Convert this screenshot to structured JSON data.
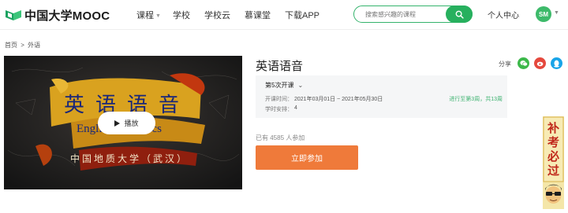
{
  "header": {
    "logo_text": "中国大学MOOC",
    "nav": [
      {
        "label": "课程",
        "has_caret": true
      },
      {
        "label": "学校"
      },
      {
        "label": "学校云"
      },
      {
        "label": "慕课堂"
      },
      {
        "label": "下载APP"
      }
    ],
    "search_placeholder": "搜索感兴趣的课程",
    "personal_center": "个人中心",
    "avatar_text": "SM"
  },
  "breadcrumb": {
    "items": [
      "首页",
      "外语"
    ],
    "separator": ">"
  },
  "video": {
    "banner_title": "英语语音",
    "banner_subtitle": "English Phonetics",
    "banner_university": "中国地质大学（武汉）",
    "play_label": "播放"
  },
  "course": {
    "title": "英语语音",
    "share_label": "分享",
    "session": {
      "selected": "第5次开课",
      "time_label": "开课时间：",
      "time_value": "2021年03月01日 ~ 2021年05月30日",
      "schedule_label": "学时安排：",
      "schedule_value": "4",
      "progress": "进行至第3周，共13周"
    },
    "joined_text": "已有 4585 人参加",
    "join_button": "立即参加"
  },
  "side_ad": {
    "text": "补考必过"
  },
  "colors": {
    "brand_green": "#27b05e",
    "join_orange": "#ef7a3a",
    "progress_green": "#3eb370"
  }
}
